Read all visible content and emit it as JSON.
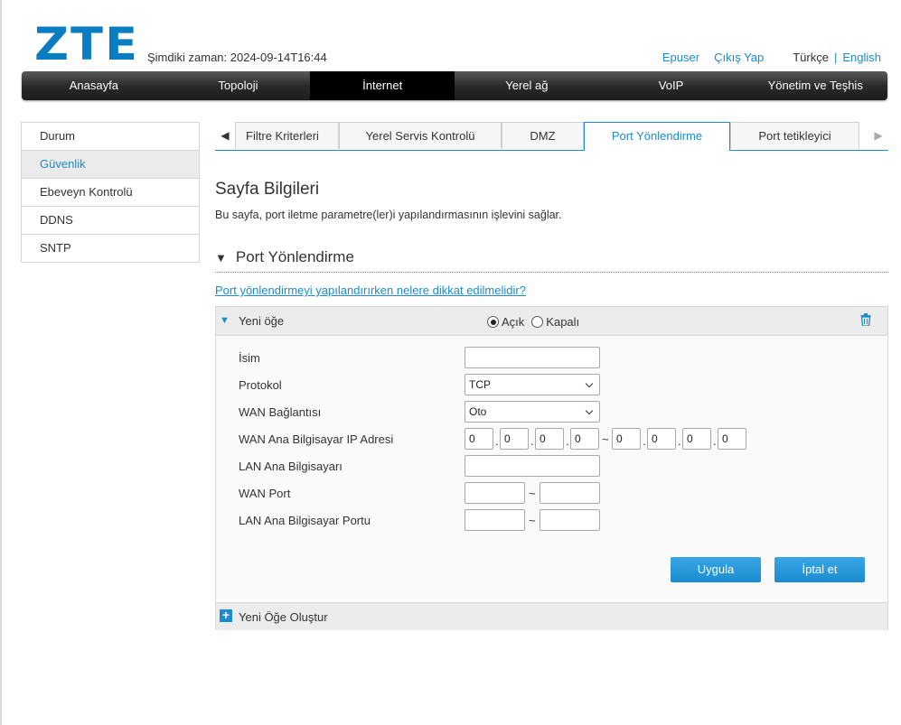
{
  "brand": "ZTE",
  "header": {
    "current_time": "Şimdiki zaman: 2024-09-14T16:44",
    "links": {
      "user": "Epuser",
      "logout": "Çıkış Yap",
      "lang_tr": "Türkçe",
      "lang_sep": "|",
      "lang_en": "English"
    }
  },
  "nav": [
    "Anasayfa",
    "Topoloji",
    "İnternet",
    "Yerel ağ",
    "VoIP",
    "Yönetim ve Teşhis"
  ],
  "nav_active": "İnternet",
  "sidebar": [
    {
      "label": "Durum"
    },
    {
      "label": "Güvenlik",
      "active": true
    },
    {
      "label": "Ebeveyn Kontrolü"
    },
    {
      "label": "DDNS"
    },
    {
      "label": "SNTP"
    }
  ],
  "tabs": [
    {
      "label": "Filtre Kriterleri"
    },
    {
      "label": "Yerel Servis Kontrolü"
    },
    {
      "label": "DMZ"
    },
    {
      "label": "Port Yönlendirme",
      "active": true
    },
    {
      "label": "Port tetikleyici"
    }
  ],
  "page": {
    "title": "Sayfa Bilgileri",
    "description": "Bu sayfa, port iletme parametre(ler)i yapılandırmasının işlevini sağlar.",
    "section": "Port Yönlendirme",
    "help_link": "Port yönlendirmeyi yapılandırırken nelere dikkat edilmelidir?"
  },
  "panel": {
    "title": "Yeni öğe",
    "radio_on": "Açık",
    "radio_off": "Kapalı",
    "fields": {
      "name": {
        "label": "İsim",
        "value": ""
      },
      "protocol": {
        "label": "Protokol",
        "value": "TCP"
      },
      "wan_conn": {
        "label": "WAN Bağlantısı",
        "value": "Oto"
      },
      "wan_ip": {
        "label": "WAN Ana Bilgisayar IP Adresi",
        "start": [
          "0",
          "0",
          "0",
          "0"
        ],
        "end": [
          "0",
          "0",
          "0",
          "0"
        ]
      },
      "lan_host": {
        "label": "LAN Ana Bilgisayarı",
        "value": ""
      },
      "wan_port": {
        "label": "WAN Port",
        "start": "",
        "end": ""
      },
      "lan_port": {
        "label": "LAN Ana Bilgisayar Portu",
        "start": "",
        "end": ""
      }
    },
    "apply": "Uygula",
    "cancel": "İptal et",
    "create_new": "Yeni Öğe Oluştur"
  },
  "colors": {
    "accent": "#1a8ccf",
    "nav_bg": "#2a2a2a"
  }
}
